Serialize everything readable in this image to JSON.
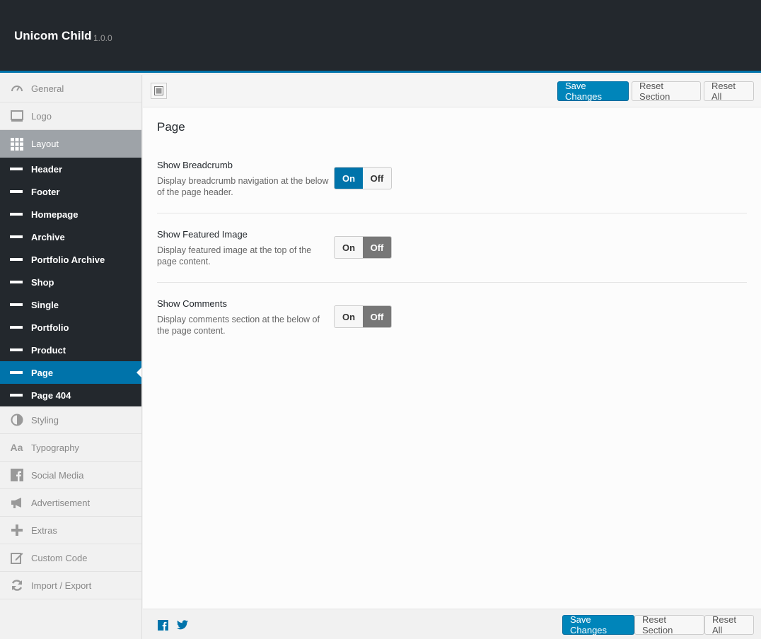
{
  "header": {
    "title": "Unicom Child",
    "version": "1.0.0"
  },
  "sidebar": {
    "items_before": [
      {
        "label": "General",
        "icon": "dashboard-icon"
      },
      {
        "label": "Logo",
        "icon": "monitor-icon"
      },
      {
        "label": "Layout",
        "icon": "grid-icon"
      }
    ],
    "sub_items": [
      "Header",
      "Footer",
      "Homepage",
      "Archive",
      "Portfolio Archive",
      "Shop",
      "Single",
      "Portfolio",
      "Product",
      "Page",
      "Page 404"
    ],
    "current_sub": "Page",
    "items_after": [
      {
        "label": "Styling",
        "icon": "contrast-icon"
      },
      {
        "label": "Typography",
        "icon": "typography-icon"
      },
      {
        "label": "Social Media",
        "icon": "facebook-icon"
      },
      {
        "label": "Advertisement",
        "icon": "megaphone-icon"
      },
      {
        "label": "Extras",
        "icon": "plus-icon"
      },
      {
        "label": "Custom Code",
        "icon": "edit-icon"
      },
      {
        "label": "Import / Export",
        "icon": "refresh-icon"
      }
    ]
  },
  "toolbar": {
    "save_label": "Save Changes",
    "reset_section_label": "Reset Section",
    "reset_all_label": "Reset All"
  },
  "section": {
    "title": "Page",
    "fields": [
      {
        "label": "Show Breadcrumb",
        "desc": "Display breadcrumb navigation at the below of the page header.",
        "on_label": "On",
        "off_label": "Off",
        "value": "On"
      },
      {
        "label": "Show Featured Image",
        "desc": "Display featured image at the top of the page content.",
        "on_label": "On",
        "off_label": "Off",
        "value": "Off"
      },
      {
        "label": "Show Comments",
        "desc": "Display comments section at the below of the page content.",
        "on_label": "On",
        "off_label": "Off",
        "value": "Off"
      }
    ]
  },
  "footer": {
    "save_label": "Save Changes",
    "reset_section_label": "Reset Section",
    "reset_all_label": "Reset All"
  },
  "colors": {
    "accent": "#0073aa",
    "header_bg": "#23282d",
    "off_selected": "#777777"
  }
}
